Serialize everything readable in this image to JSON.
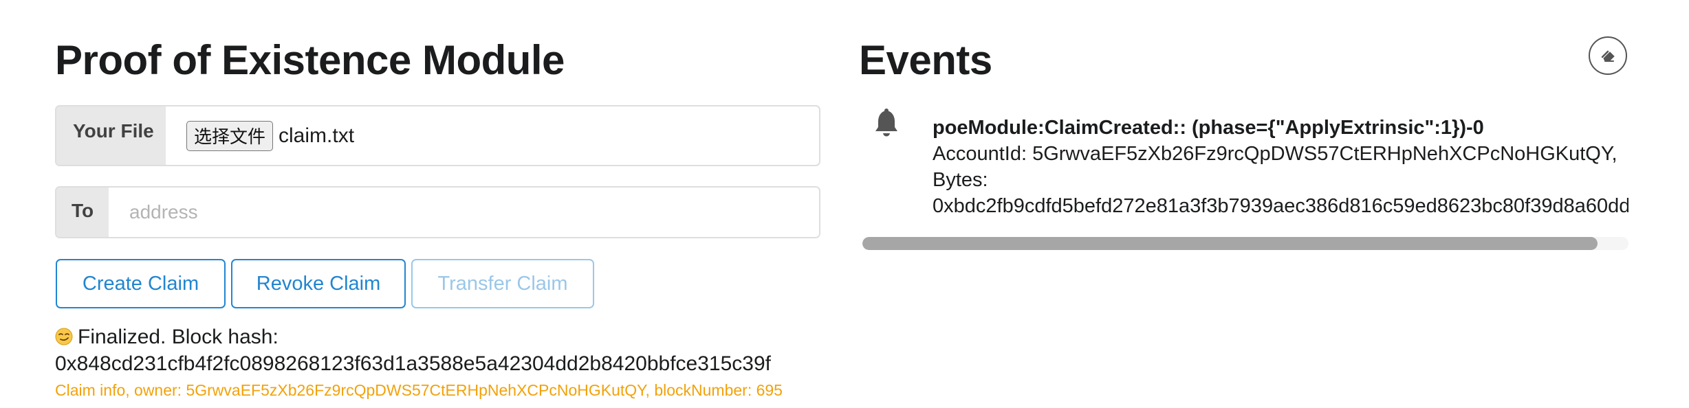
{
  "poe": {
    "title": "Proof of Existence Module",
    "file": {
      "label": "Your File",
      "choose_button": "选择文件",
      "file_name": "claim.txt"
    },
    "to": {
      "label": "To",
      "placeholder": "address",
      "value": ""
    },
    "buttons": {
      "create": "Create Claim",
      "revoke": "Revoke Claim",
      "transfer": "Transfer Claim"
    },
    "status": {
      "icon": "smirking-face-emoji",
      "text": "Finalized. Block hash:",
      "hash": "0x848cd231cfb4f2fc0898268123f63d1a3588e5a42304dd2b8420bbfce315c39f",
      "claim_info": "Claim info, owner: 5GrwvaEF5zXb26Fz9rcQpDWS57CtERHpNehXCPcNoHGKutQY, blockNumber: 695"
    }
  },
  "events": {
    "title": "Events",
    "clear_icon": "eraser-icon",
    "items": [
      {
        "icon": "bell-icon",
        "title": "poeModule:ClaimCreated:: (phase={\"ApplyExtrinsic\":1})-0",
        "account": "AccountId: 5GrwvaEF5zXb26Fz9rcQpDWS57CtERHpNehXCPcNoHGKutQY,",
        "bytes_label": "Bytes:",
        "bytes_value": "0xbdc2fb9cdfd5befd272e81a3f3b7939aec386d816c59ed8623bc80f39d8a60dd"
      }
    ],
    "scroll_position": 0.96
  },
  "colors": {
    "primary": "#2185d0",
    "warning": "#f2a20a",
    "text": "#1b1c1d",
    "muted_border": "#dedede",
    "scrollbar": "#a6a6a6"
  }
}
